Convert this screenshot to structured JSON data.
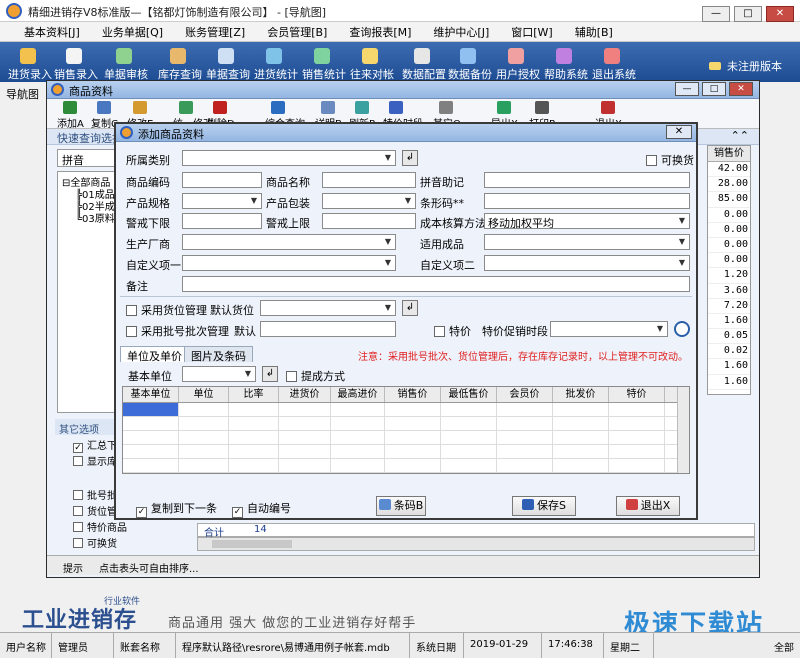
{
  "app": {
    "title": "精细进销存V8标准版—【铭都灯饰制造有限公司】 - [导航图]",
    "menu": [
      "基本资料[J]",
      "业务单据[Q]",
      "账务管理[Z]",
      "会员管理[B]",
      "查询报表[M]",
      "维护中心[J]",
      "窗口[W]",
      "辅助[B]"
    ],
    "toolbar": [
      {
        "label": "进货录入",
        "icon": "truck-icon",
        "color": "#f2c14e"
      },
      {
        "label": "销售录入",
        "icon": "cart-icon",
        "color": "#f4f4f4"
      },
      {
        "label": "单据审核",
        "icon": "check-doc-icon",
        "color": "#8fd28f"
      },
      {
        "label": "库存查询",
        "icon": "box-icon",
        "color": "#e8b86d"
      },
      {
        "label": "单据查询",
        "icon": "doc-search-icon",
        "color": "#cfe0f5"
      },
      {
        "label": "进货统计",
        "icon": "chart-icon",
        "color": "#7fc4e8"
      },
      {
        "label": "销售统计",
        "icon": "chart-icon",
        "color": "#7fd39e"
      },
      {
        "label": "往来对帐",
        "icon": "account-icon",
        "color": "#f5d76e"
      },
      {
        "label": "数据配置",
        "icon": "config-icon",
        "color": "#e6e6e6"
      },
      {
        "label": "数据备份",
        "icon": "backup-icon",
        "color": "#90c0f0"
      },
      {
        "label": "用户授权",
        "icon": "user-icon",
        "color": "#f0a0a0"
      },
      {
        "label": "帮助系统",
        "icon": "help-icon",
        "color": "#c080e0"
      },
      {
        "label": "退出系统",
        "icon": "exit-icon",
        "color": "#f08080"
      }
    ],
    "unregistered": "未注册版本",
    "nav_tab": "导航图",
    "brand_logo": "工业进销存",
    "brand_small": "行业软件",
    "slogan": "商品通用 强大 做您的工业进销存好帮手",
    "status": {
      "user_label": "用户名称",
      "user_value": "管理员",
      "book_label": "账套名称",
      "book_value": "程序默认路径\\resrore\\易博通用例子帐套.mdb",
      "date_label": "系统日期",
      "date_value": "2019-01-29",
      "time_value": "17:46:38",
      "weekday": "星期二",
      "mode": "全部"
    },
    "watermark": "极速下载站"
  },
  "product_window": {
    "title": "商品资料",
    "toolbar": [
      "添加A",
      "复制C",
      "修改E",
      "统一修改",
      "删除D",
      "综合查询",
      "详明B",
      "刷新R",
      "特价时段",
      "其它O",
      "导出X",
      "打印P",
      "退出X"
    ],
    "quick_search": "快速查询选择",
    "pinyin": "拼音",
    "tree": [
      "全部商品",
      "01成品",
      "02半成",
      "03原料"
    ],
    "other_options_title": "其它选项",
    "options_top": [
      {
        "label": "汇总下",
        "checked": true
      },
      {
        "label": "显示库",
        "checked": false
      }
    ],
    "options_bottom": [
      {
        "label": "批号批",
        "checked": false
      },
      {
        "label": "货位管",
        "checked": false
      },
      {
        "label": "特价商品",
        "checked": false
      },
      {
        "label": "可换货",
        "checked": false
      }
    ],
    "price_col_header": "销售价",
    "price_col": [
      "42.00",
      "28.00",
      "85.00",
      "0.00",
      "0.00",
      "0.00",
      "0.00",
      "1.20",
      "3.60",
      "7.20",
      "1.60",
      "0.05",
      "0.02",
      "1.60",
      "1.60"
    ],
    "sum_label": "合计",
    "sum_value": "14",
    "status_tip": "提示",
    "status_text": "点击表头可自由排序..."
  },
  "dialog": {
    "title": "添加商品资料",
    "labels": {
      "category": "所属类别",
      "exchangeable": "可换货",
      "code": "商品编码",
      "name": "商品名称",
      "pinyin": "拼音助记",
      "spec": "产品规格",
      "package": "产品包装",
      "barcode": "条形码**",
      "warn_low": "警戒下限",
      "warn_high": "警戒上限",
      "cost_method": "成本核算方法",
      "maker": "生产厂商",
      "applicable": "适用成品",
      "custom1": "自定义项一",
      "custom2": "自定义项二",
      "remark": "备注",
      "use_location": "采用货位管理",
      "default_location": "默认货位",
      "use_batch": "采用批号批次管理",
      "default": "默认",
      "special": "特价",
      "special_period": "特价促销时段"
    },
    "values": {
      "cost_method": "移动加权平均"
    },
    "notice": "注意：采用批号批次、货位管理后，存在库存记录时，以上管理不可改动。",
    "tabs": [
      "单位及单价",
      "图片及条码"
    ],
    "base_unit_label": "基本单位",
    "commission_label": "提成方式",
    "grid_headers": [
      "基本单位",
      "单位",
      "比率",
      "进货价",
      "最高进价",
      "销售价",
      "最低售价",
      "会员价",
      "批发价",
      "特价"
    ],
    "copy_next": "复制到下一条",
    "auto_code": "自动编号",
    "barcode_button": "条码B",
    "save_button": "保存S",
    "exit_button": "退出X"
  }
}
